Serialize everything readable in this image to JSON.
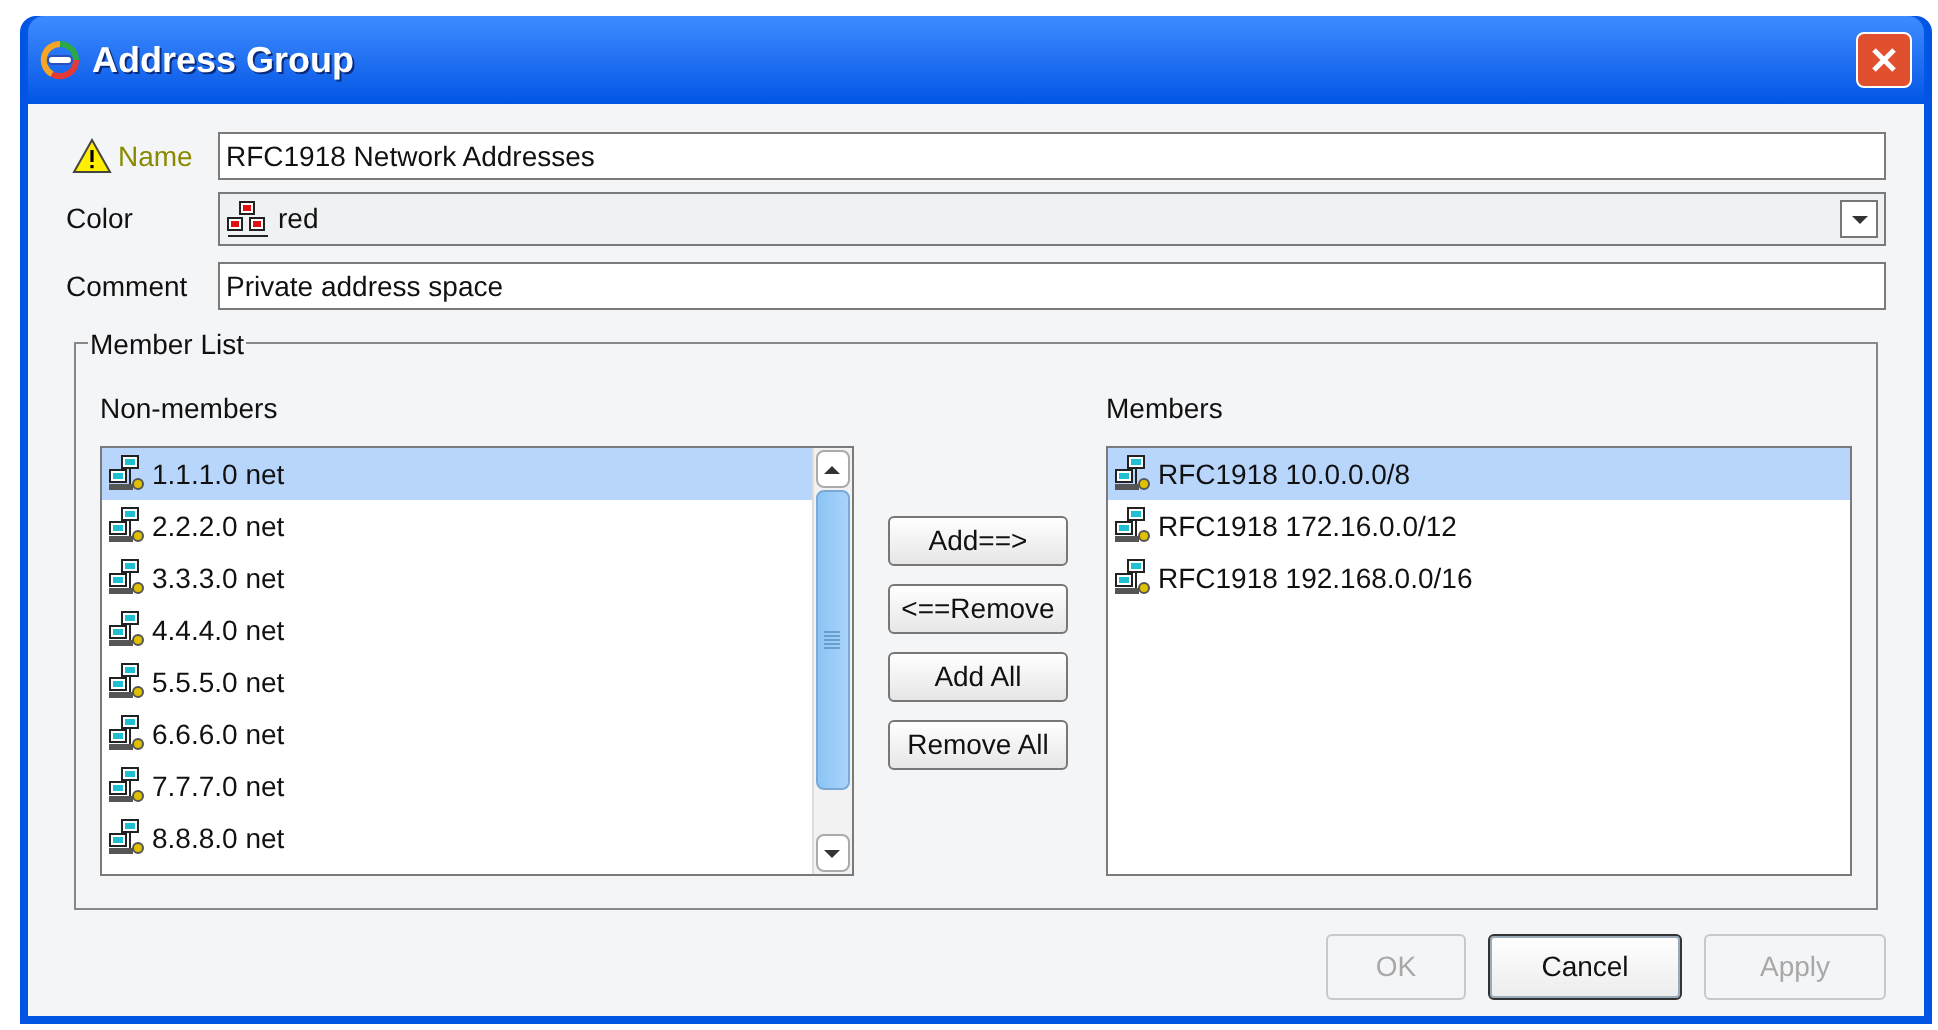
{
  "window": {
    "title": "Address Group"
  },
  "form": {
    "name": {
      "label": "Name",
      "value": "RFC1918 Network Addresses",
      "warning": true
    },
    "color": {
      "label": "Color",
      "value": "red"
    },
    "comment": {
      "label": "Comment",
      "value": "Private address space"
    }
  },
  "member_list": {
    "title": "Member List",
    "non_members": {
      "label": "Non-members",
      "items": [
        {
          "text": "1.1.1.0 net",
          "selected": true
        },
        {
          "text": "2.2.2.0 net",
          "selected": false
        },
        {
          "text": "3.3.3.0 net",
          "selected": false
        },
        {
          "text": "4.4.4.0 net",
          "selected": false
        },
        {
          "text": "5.5.5.0 net",
          "selected": false
        },
        {
          "text": "6.6.6.0 net",
          "selected": false
        },
        {
          "text": "7.7.7.0 net",
          "selected": false
        },
        {
          "text": "8.8.8.0 net",
          "selected": false
        }
      ]
    },
    "actions": [
      "Add==>",
      "<==Remove",
      "Add All",
      "Remove All"
    ],
    "members": {
      "label": "Members",
      "items": [
        {
          "text": "RFC1918 10.0.0.0/8",
          "selected": true
        },
        {
          "text": "RFC1918 172.16.0.0/12",
          "selected": false
        },
        {
          "text": "RFC1918 192.168.0.0/16",
          "selected": false
        }
      ]
    }
  },
  "buttons": [
    {
      "label": "OK",
      "disabled": true,
      "default": false
    },
    {
      "label": "Cancel",
      "disabled": false,
      "default": true
    },
    {
      "label": "Apply",
      "disabled": true,
      "default": false
    }
  ]
}
